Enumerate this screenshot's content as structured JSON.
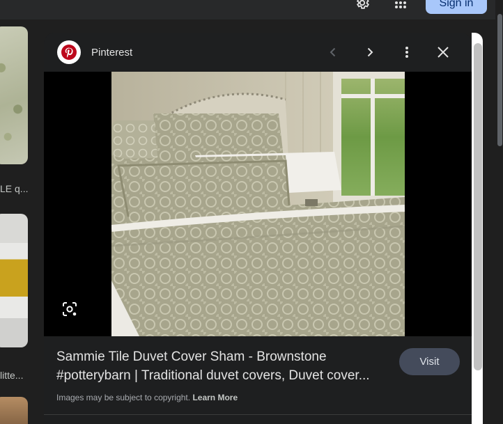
{
  "header": {
    "sign_in_label": "Sign in",
    "settings_icon": "gear-icon",
    "apps_icon": "apps-grid-icon"
  },
  "results": {
    "captions": [
      "LE q...",
      "litte..."
    ]
  },
  "panel": {
    "source_name": "Pinterest",
    "source_icon": "pinterest-icon",
    "icons": {
      "prev": "chevron-left-icon",
      "next": "chevron-right-icon",
      "more": "more-vert-icon",
      "close": "close-icon",
      "lens": "lens-search-icon"
    },
    "title_line1": "Sammie Tile Duvet Cover Sham - Brownstone",
    "title_line2": "#potterybarn | Traditional duvet covers, Duvet cover...",
    "visit_label": "Visit",
    "copyright_text": "Images may be subject to copyright.",
    "learn_more": "Learn More"
  },
  "colors": {
    "background": "#1f1f1f",
    "accent": "#a8c7fa",
    "visit_button": "#444b5b",
    "pinterest_red": "#bd081c"
  }
}
